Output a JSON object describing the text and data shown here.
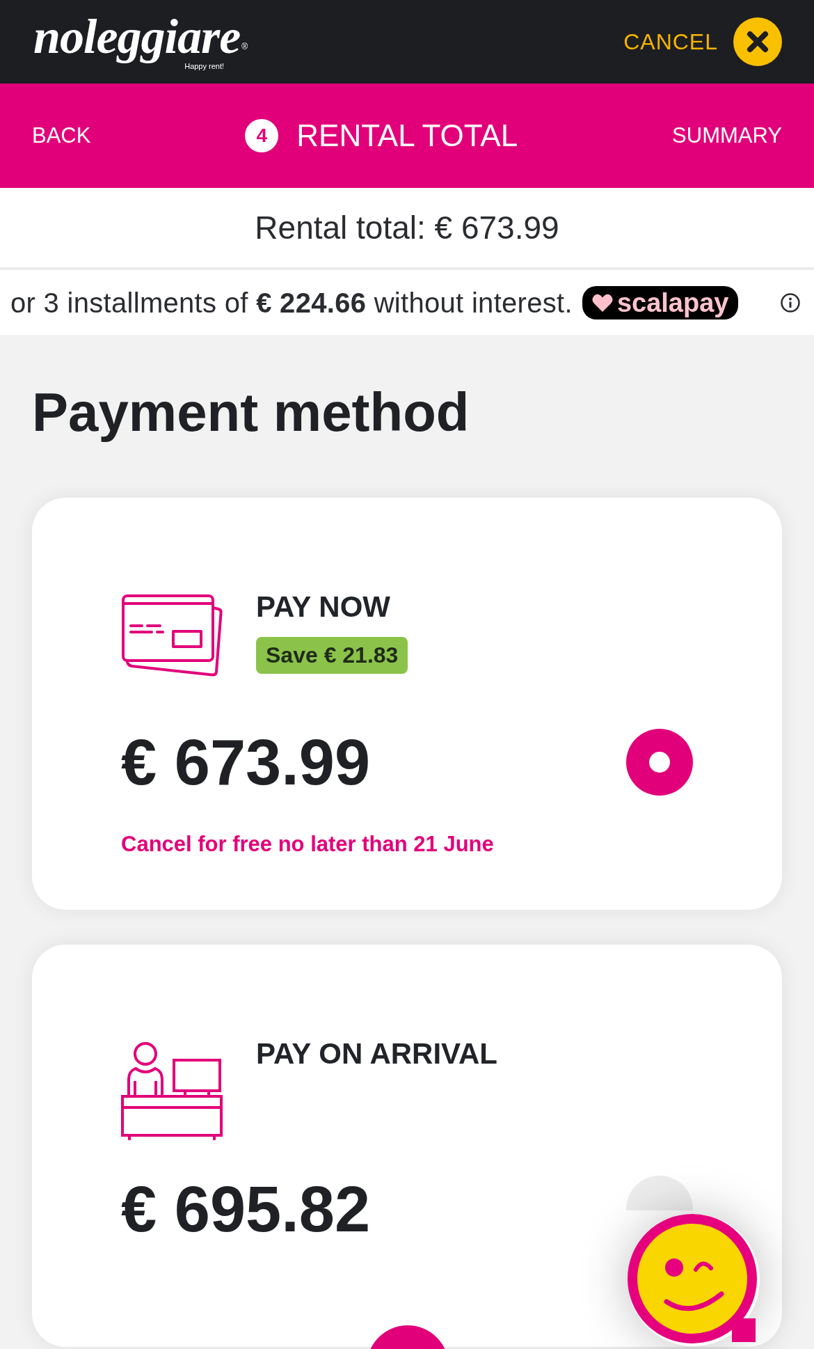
{
  "header": {
    "logo": {
      "wordmark": "noleggiare",
      "tagline": "Happy rent!",
      "registered": "®"
    },
    "cancel_button": "CANCEL"
  },
  "step_bar": {
    "back": "BACK",
    "step_number": "4",
    "title": "RENTAL TOTAL",
    "next": "SUMMARY"
  },
  "rental_total": "Rental total: € 673.99",
  "installments": {
    "text": "or 3 installments of **€ 224.66** without interest.",
    "provider": "scalapay"
  },
  "section_title": "Payment method",
  "payment_options": [
    {
      "kind": "card",
      "title": "PAY NOW",
      "badge": "Save € 21.83",
      "price": "€ 673.99",
      "note": "Cancel for free no later than 21 June",
      "selected": true
    },
    {
      "kind": "desk",
      "title": "PAY ON ARRIVAL",
      "price": "€ 695.82",
      "selected": false
    }
  ]
}
